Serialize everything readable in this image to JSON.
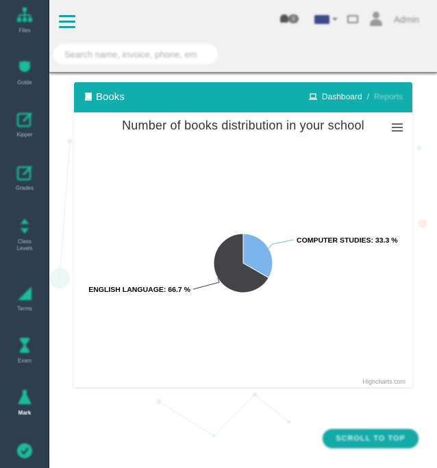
{
  "sidebar": {
    "items": [
      {
        "label": "Files",
        "icon": "sitemap-icon"
      },
      {
        "label": "Golde",
        "icon": "graduate-icon"
      },
      {
        "label": "Kipper",
        "icon": "edit-icon"
      },
      {
        "label": "Grades",
        "icon": "edit-icon"
      },
      {
        "label": "Class",
        "label2": "Levels",
        "icon": "sort-icon"
      },
      {
        "label": "Terms",
        "icon": "signal-icon"
      },
      {
        "label": "Exam",
        "icon": "hourglass-icon"
      },
      {
        "label": "Mark",
        "icon": "flask-icon"
      },
      {
        "label": "",
        "icon": "check-circle-icon"
      }
    ]
  },
  "topbar": {
    "notification_count": "0",
    "user_label": "Admin",
    "search_placeholder": "Search name, invoice, phone, em"
  },
  "card": {
    "title": "Books",
    "breadcrumb_home": "Dashboard",
    "breadcrumb_separator": "/",
    "breadcrumb_current": "Reports"
  },
  "chart_data": {
    "type": "pie",
    "title": "Number of books distribution in your school",
    "slices": [
      {
        "label": "COMPUTER STUDIES",
        "value": 33.3,
        "display": "COMPUTER STUDIES: 33.3 %",
        "color": "#7cb5ec"
      },
      {
        "label": "ENGLISH LANGUAGE",
        "value": 66.7,
        "display": "ENGLISH LANGUAGE: 66.7 %",
        "color": "#434348"
      }
    ],
    "credits": "Highcharts.com"
  },
  "footer": {
    "scroll_top_label": "SCROLL TO TOP"
  },
  "colors": {
    "accent": "#10aeac",
    "sidebar": "#2c3e50"
  }
}
